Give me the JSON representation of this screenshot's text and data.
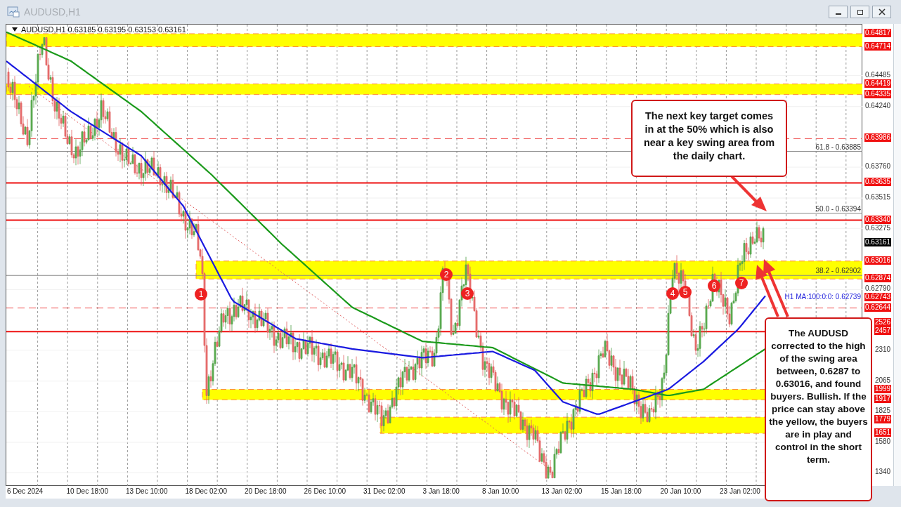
{
  "window": {
    "title": "AUDUSD,H1"
  },
  "chart": {
    "header": "AUDUSD,H1  0.63185 0.63195 0.63153 0.63161",
    "price_labels": [
      {
        "text": "0.64817",
        "kind": "level"
      },
      {
        "text": "0.64714",
        "kind": "level"
      },
      {
        "text": "0.64485",
        "kind": "plain"
      },
      {
        "text": "0.64419",
        "kind": "level"
      },
      {
        "text": "0.64335",
        "kind": "level"
      },
      {
        "text": "0.64240",
        "kind": "plain"
      },
      {
        "text": "0.63986",
        "kind": "level"
      },
      {
        "text": "0.63760",
        "kind": "plain"
      },
      {
        "text": "0.63635",
        "kind": "level"
      },
      {
        "text": "0.63515",
        "kind": "plain"
      },
      {
        "text": "0.63340",
        "kind": "level"
      },
      {
        "text": "0.63275",
        "kind": "plain"
      },
      {
        "text": "0.63161",
        "kind": "current"
      },
      {
        "text": "0.63016",
        "kind": "level"
      },
      {
        "text": "0.62874",
        "kind": "level"
      },
      {
        "text": "0.62790",
        "kind": "plain"
      },
      {
        "text": "0.62743",
        "kind": "level"
      },
      {
        "text": "0.62644",
        "kind": "level"
      },
      {
        "text": "2526",
        "kind": "level"
      },
      {
        "text": "2457",
        "kind": "level"
      },
      {
        "text": "2310",
        "kind": "plain"
      },
      {
        "text": "2065",
        "kind": "plain"
      },
      {
        "text": "1999",
        "kind": "level"
      },
      {
        "text": "1917",
        "kind": "level"
      },
      {
        "text": "1825",
        "kind": "plain"
      },
      {
        "text": "1779",
        "kind": "level"
      },
      {
        "text": "1651",
        "kind": "level"
      },
      {
        "text": "1580",
        "kind": "plain"
      },
      {
        "text": "1340",
        "kind": "plain"
      }
    ],
    "time_labels": [
      "6 Dec 2024",
      "10 Dec 18:00",
      "13 Dec 10:00",
      "18 Dec 02:00",
      "20 Dec 18:00",
      "26 Dec 10:00",
      "31 Dec 02:00",
      "3 Jan 18:00",
      "8 Jan 10:00",
      "13 Jan 02:00",
      "15 Jan 18:00",
      "20 Jan 10:00",
      "23 Jan 02:00"
    ],
    "fib_labels": [
      "61.8 - 0.63885",
      "50.0 - 0.63394",
      "38.2 - 0.62902"
    ],
    "ma_label": "H1 MA:100:0:0: 0.62739",
    "markers": [
      "1",
      "2",
      "3",
      "4",
      "5",
      "6",
      "7"
    ],
    "callouts": [
      "The next key target comes in at the 50% which is also near a key swing area from the daily chart.",
      "The AUDUSD corrected to the high of the swing area between, 0.6287 to 0.63016, and found buyers. Bullish. If the price can stay above the yellow, the buyers are in play and control in the short term."
    ]
  }
}
